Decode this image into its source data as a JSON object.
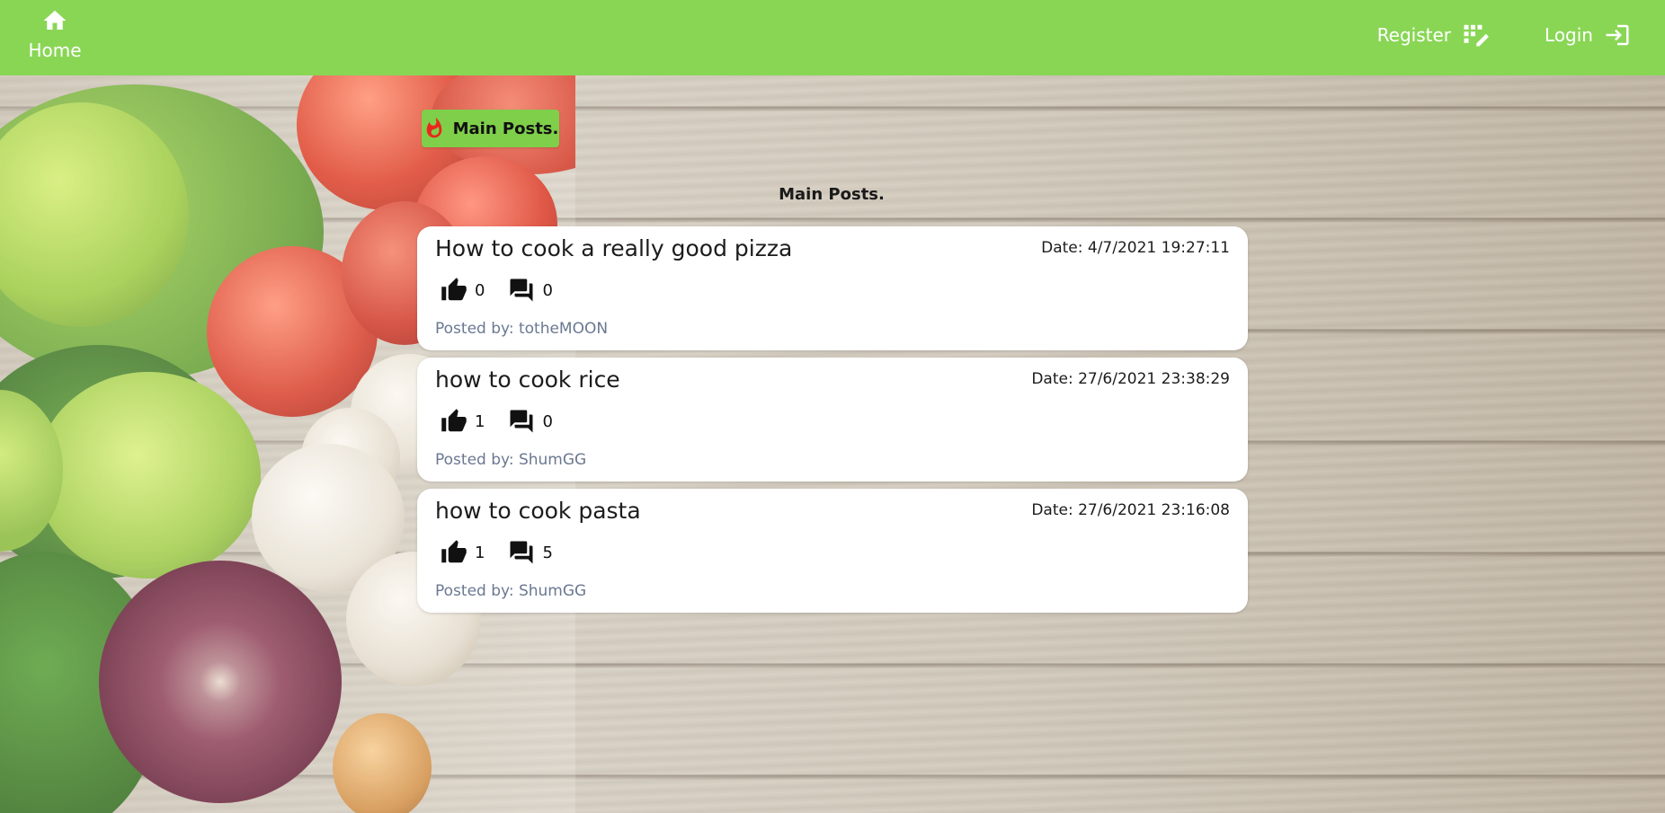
{
  "navbar": {
    "home_label": "Home",
    "register_label": "Register",
    "login_label": "Login",
    "icons": {
      "home": "home-icon",
      "register": "register-icon",
      "login": "login-icon"
    }
  },
  "section": {
    "badge_label": "Main Posts.",
    "badge_icon": "fire-icon",
    "heading": "Main Posts."
  },
  "posts": [
    {
      "title": "How to cook a really good pizza",
      "date": "Date: 4/7/2021 19:27:11",
      "likes": "0",
      "comments": "0",
      "author": "Posted by: totheMOON"
    },
    {
      "title": "how to cook rice",
      "date": "Date: 27/6/2021 23:38:29",
      "likes": "1",
      "comments": "0",
      "author": "Posted by: ShumGG"
    },
    {
      "title": "how to cook pasta",
      "date": "Date: 27/6/2021 23:16:08",
      "likes": "1",
      "comments": "5",
      "author": "Posted by: ShumGG"
    }
  ],
  "colors": {
    "navbar": "#89d655",
    "badge": "#7fcf4a",
    "card": "#ffffff",
    "author_text": "#6b7891"
  }
}
